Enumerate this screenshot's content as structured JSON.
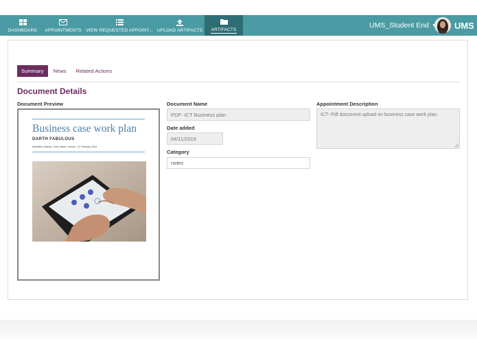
{
  "nav": {
    "items": [
      {
        "label": "DASHBOARD",
        "icon": "dashboard-icon"
      },
      {
        "label": "APPOINTMENTS",
        "icon": "envelope-icon"
      },
      {
        "label": "VIEW REQUESTED APPOINT...",
        "icon": "list-icon"
      },
      {
        "label": "UPLOAD ARTIFACTS",
        "icon": "upload-icon"
      },
      {
        "label": "ARTIFACTS",
        "icon": "folder-icon",
        "active": true
      }
    ],
    "user_label": "UMS_Student End",
    "logo_text": "UMS"
  },
  "tabs": [
    {
      "label": "Summary",
      "active": true
    },
    {
      "label": "News"
    },
    {
      "label": "Related Actions"
    }
  ],
  "section_title": "Document Details",
  "preview": {
    "label": "Document Preview",
    "doc_title": "Business case work plan",
    "doc_subtitle": "DARTH FABULOUS",
    "doc_authors": "Niveditha, Nathan, Colin, Brian, Human - 11 February 2018"
  },
  "fields": {
    "document_name": {
      "label": "Document Name",
      "value": "PDF- ICT Business plan"
    },
    "date_added": {
      "label": "Date added",
      "value": "04/11/2019"
    },
    "category": {
      "label": "Category",
      "value": "notes"
    },
    "appointment_description": {
      "label": "Appointment Description",
      "value": "ICT- Pdf document upload on business case work plan."
    }
  },
  "colors": {
    "header": "#4a9ba3",
    "header_active": "#2e6d74",
    "accent": "#6b2c5f",
    "doc_title": "#4a7ea8"
  }
}
